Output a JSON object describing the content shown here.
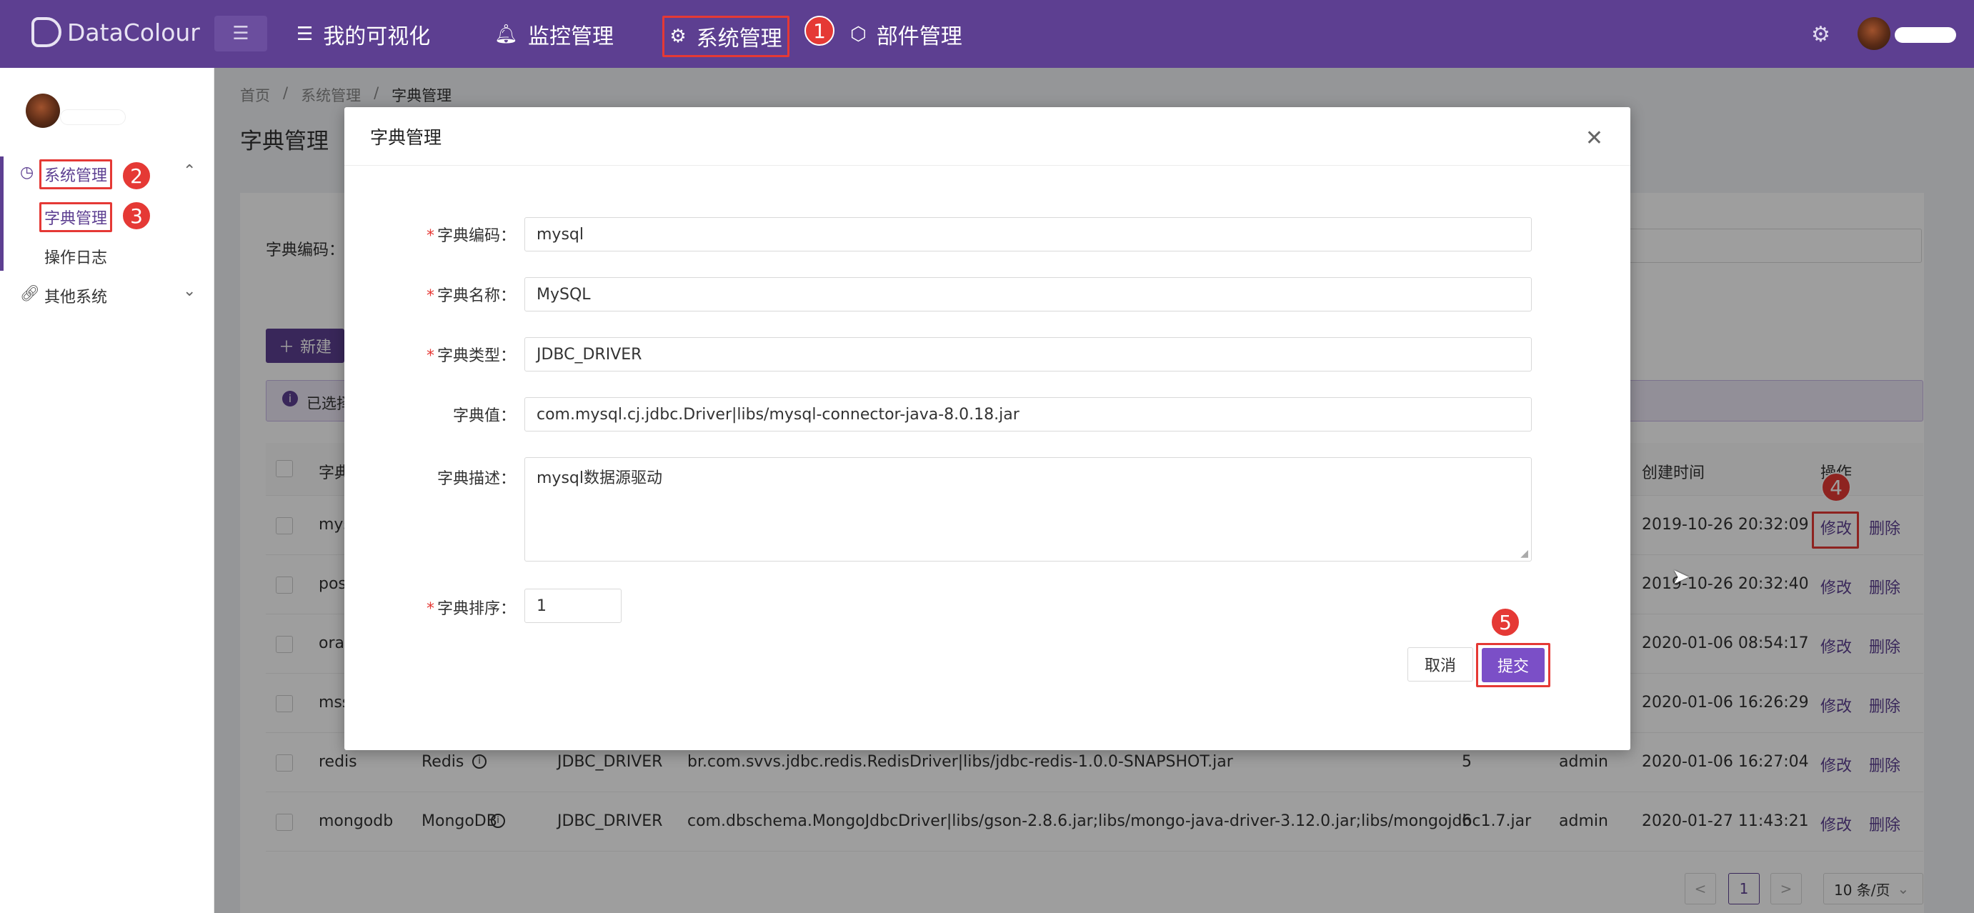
{
  "app": {
    "logo": "DataColour"
  },
  "topnav": {
    "items": [
      {
        "label": "我的可视化"
      },
      {
        "label": "监控管理"
      },
      {
        "label": "系统管理"
      },
      {
        "label": "部件管理"
      }
    ]
  },
  "sidebar": {
    "items": [
      {
        "label": "系统管理"
      },
      {
        "label": "字典管理"
      },
      {
        "label": "操作日志"
      },
      {
        "label": "其他系统"
      }
    ]
  },
  "breadcrumb": [
    "首页",
    "/",
    "系统管理",
    "/",
    "字典管理"
  ],
  "page": {
    "title": "字典管理",
    "filter_label": "字典编码：",
    "new_button": "新建",
    "selected_info": "已选择"
  },
  "table": {
    "headers": {
      "code": "字典",
      "created": "创建时间",
      "ops": "操作"
    },
    "rows": [
      {
        "code": "mys",
        "name": "",
        "type": "",
        "value": "",
        "sort": "",
        "user": "",
        "created": "2019-10-26 20:32:09"
      },
      {
        "code": "pos",
        "name": "",
        "type": "",
        "value": "",
        "sort": "",
        "user": "",
        "created": "2019-10-26 20:32:40"
      },
      {
        "code": "orac",
        "name": "",
        "type": "",
        "value": "",
        "sort": "",
        "user": "",
        "created": "2020-01-06 08:54:17"
      },
      {
        "code": "mss",
        "name": "",
        "type": "",
        "value": "",
        "sort": "",
        "user": "",
        "created": "2020-01-06 16:26:29"
      },
      {
        "code": "redis",
        "name": "Redis",
        "type": "JDBC_DRIVER",
        "value": "br.com.svvs.jdbc.redis.RedisDriver|libs/jdbc-redis-1.0.0-SNAPSHOT.jar",
        "sort": "5",
        "user": "admin",
        "created": "2020-01-06 16:27:04"
      },
      {
        "code": "mongodb",
        "name": "MongoDB",
        "type": "JDBC_DRIVER",
        "value": "com.dbschema.MongoJdbcDriver|libs/gson-2.8.6.jar;libs/mongo-java-driver-3.12.0.jar;libs/mongojdbc1.7.jar",
        "sort": "6",
        "user": "admin",
        "created": "2020-01-27 11:43:21"
      }
    ],
    "edit_label": "修改",
    "delete_label": "删除"
  },
  "pagination": {
    "prev": "<",
    "current": "1",
    "next": ">",
    "page_size": "10 条/页"
  },
  "modal": {
    "title": "字典管理",
    "fields": {
      "code": {
        "label": "字典编码：",
        "value": "mysql"
      },
      "name": {
        "label": "字典名称：",
        "value": "MySQL"
      },
      "type": {
        "label": "字典类型：",
        "value": "JDBC_DRIVER"
      },
      "value": {
        "label": "字典值：",
        "value": "com.mysql.cj.jdbc.Driver|libs/mysql-connector-java-8.0.18.jar"
      },
      "desc": {
        "label": "字典描述：",
        "value": "mysql数据源驱动"
      },
      "sort": {
        "label": "字典排序：",
        "value": "1"
      }
    },
    "cancel": "取消",
    "submit": "提交",
    "required_mark": "*"
  },
  "badges": [
    "1",
    "2",
    "3",
    "4",
    "5"
  ],
  "colors": {
    "brand": "#5d3f91",
    "annotation": "#e53935",
    "submit": "#7b4fc7"
  }
}
